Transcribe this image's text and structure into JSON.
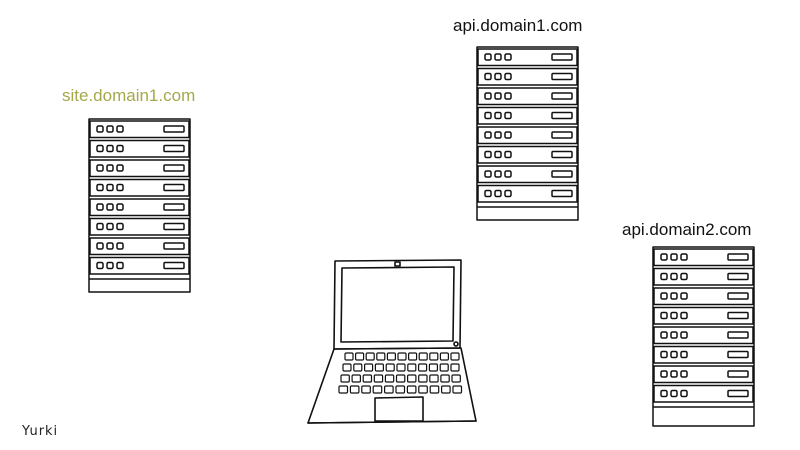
{
  "labels": {
    "site": "site.domain1.com",
    "api1": "api.domain1.com",
    "api2": "api.domain2.com"
  },
  "signature": "Yurki",
  "colors": {
    "site_label": "#a5a84a",
    "ink": "#111111",
    "background": "#ffffff"
  },
  "servers": [
    {
      "name": "server-site-domain1",
      "units": 8
    },
    {
      "name": "server-api-domain1",
      "units": 8
    },
    {
      "name": "server-api-domain2",
      "units": 8
    }
  ]
}
